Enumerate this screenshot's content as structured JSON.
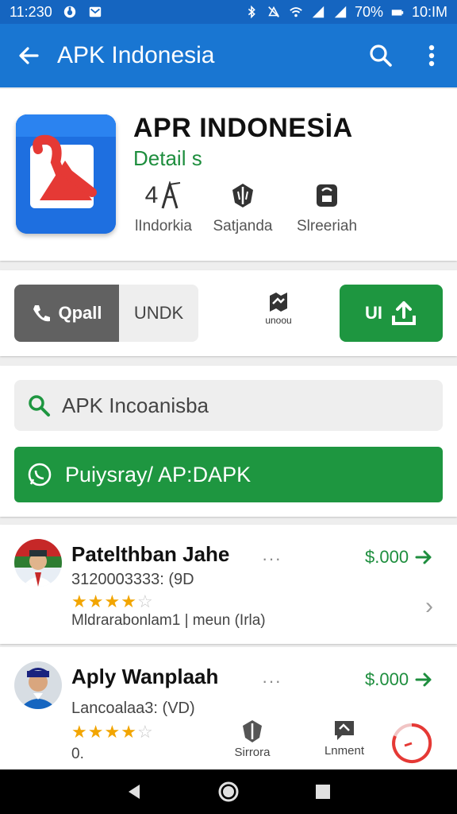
{
  "status_bar": {
    "left_time": "11:230",
    "battery": "70%",
    "right_time": "10:IM",
    "icons": [
      "instagram-like-icon",
      "mail-icon",
      "bluetooth-icon",
      "mute-icon",
      "wifi-icon",
      "signal-icon",
      "signal-icon",
      "battery-icon"
    ]
  },
  "app_bar": {
    "title": "APK Indonesia",
    "icons": [
      "back-arrow-icon",
      "search-icon",
      "more-vert-icon"
    ]
  },
  "app_header": {
    "name": "APR INDONESİA",
    "detail": "Detail s",
    "stats": [
      {
        "icon": "rating-icon",
        "value": "4",
        "label": "lIndorkia"
      },
      {
        "icon": "shield-icon",
        "label": "Satjanda"
      },
      {
        "icon": "size-icon",
        "label": "Slreeriah"
      }
    ]
  },
  "actions": {
    "seg_active": "Qpall",
    "seg_inactive": "UNDK",
    "mid_label": "unoou",
    "install_label": "UI"
  },
  "search": {
    "value": "APK Incoanisba",
    "button_label": "Puiysray/ AP:DAPK"
  },
  "list": [
    {
      "title": "Patelthban Jahe",
      "subtitle": "3120003333: (9D",
      "rating": 4,
      "description": "Mldrarabonlam1 | meun (Irla)",
      "price": "$.000"
    },
    {
      "title": "Aply Wanplaah",
      "subtitle": "Lancoalaa3: (VD)",
      "rating": 4,
      "description": "0.",
      "price": "$.000"
    }
  ],
  "bottom_actions": [
    {
      "icon": "shield-icon",
      "label": "Sirrora"
    },
    {
      "icon": "comment-icon",
      "label": "Lnment"
    }
  ],
  "colors": {
    "primary": "#1976d2",
    "status_bar": "#1565c0",
    "green": "#1e9640",
    "star": "#f2a500"
  }
}
